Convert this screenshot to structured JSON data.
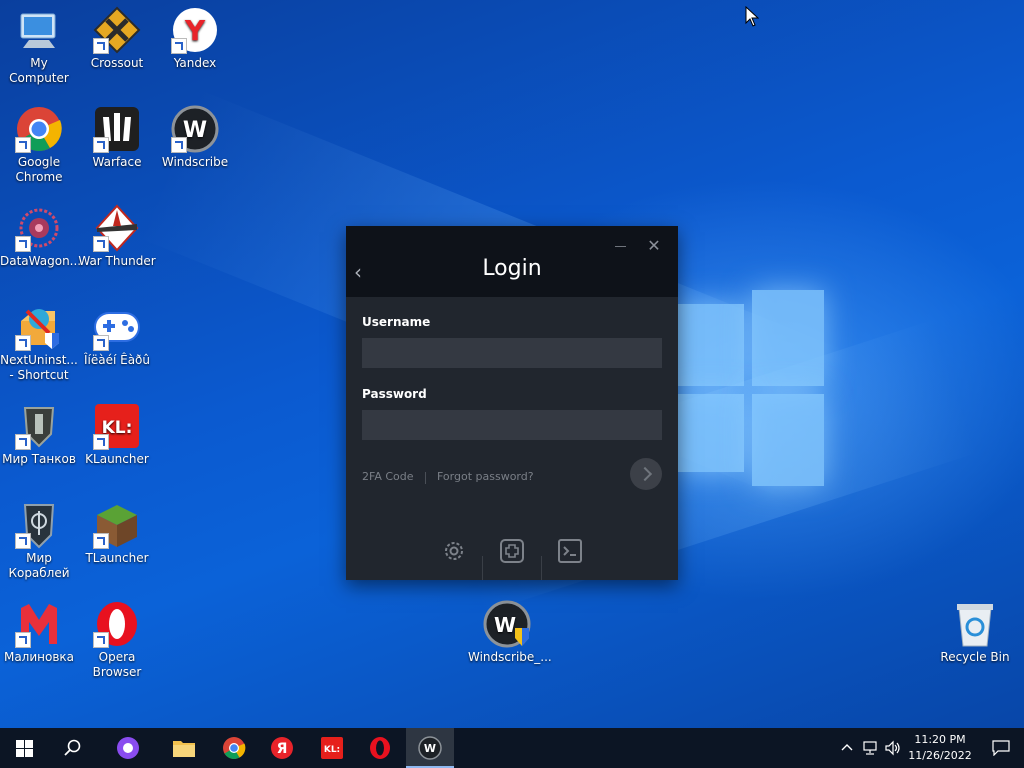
{
  "desktop": {
    "icons": [
      {
        "label": "My Computer"
      },
      {
        "label": "Crossout"
      },
      {
        "label": "Yandex"
      },
      {
        "label": "Google Chrome"
      },
      {
        "label": "Warface"
      },
      {
        "label": "Windscribe"
      },
      {
        "label": "DataWagon..."
      },
      {
        "label": "War Thunder"
      },
      {
        "label": "NextUninst... - Shortcut"
      },
      {
        "label": "Îíëàéí Êàðû"
      },
      {
        "label": "Мир Танков"
      },
      {
        "label": "KLauncher"
      },
      {
        "label": "Мир Кораблей"
      },
      {
        "label": "TLauncher"
      },
      {
        "label": "Малиновка"
      },
      {
        "label": "Opera Browser"
      },
      {
        "label": "Windscribe_..."
      },
      {
        "label": "Recycle Bin"
      }
    ]
  },
  "windscribe": {
    "title": "Login",
    "username_label": "Username",
    "username_value": "",
    "password_label": "Password",
    "password_value": "",
    "twofa_label": "2FA Code",
    "forgot_label": "Forgot password?"
  },
  "taskbar": {
    "time": "11:20 PM",
    "date": "11/26/2022"
  },
  "colors": {
    "window_bg": "#21262e",
    "window_header": "#0e1219",
    "input_bg": "#343942",
    "taskbar_bg": "#0c1524"
  }
}
